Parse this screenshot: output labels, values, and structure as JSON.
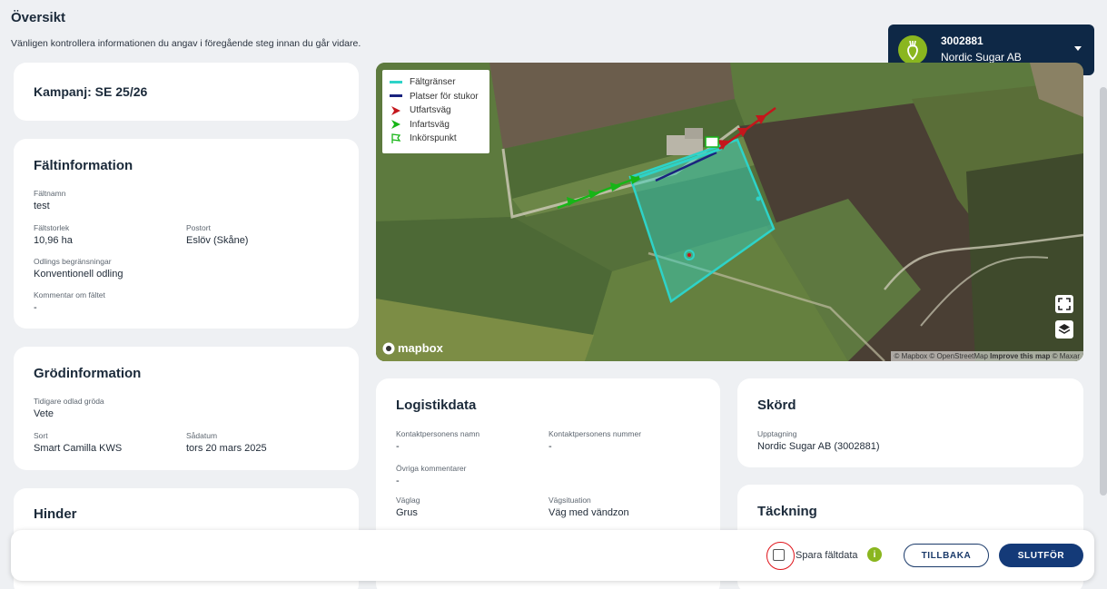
{
  "page": {
    "title": "Översikt",
    "subtitle": "Vänligen kontrollera informationen du angav i föregående steg innan du går vidare."
  },
  "account": {
    "id": "3002881",
    "name": "Nordic Sugar AB",
    "logo_icon": "sugar-beet-icon"
  },
  "campaign": {
    "label": "Kampanj: SE 25/26"
  },
  "field_info": {
    "title": "Fältinformation",
    "name_label": "Fältnamn",
    "name_value": "test",
    "size_label": "Fältstorlek",
    "size_value": "10,96 ha",
    "postort_label": "Postort",
    "postort_value": "Eslöv (Skåne)",
    "restrictions_label": "Odlings begränsningar",
    "restrictions_value": "Konventionell odling",
    "comment_label": "Kommentar om fältet",
    "comment_value": "-"
  },
  "crop_info": {
    "title": "Grödinformation",
    "previous_label": "Tidigare odlad gröda",
    "previous_value": "Vete",
    "variety_label": "Sort",
    "variety_value": "Smart Camilla KWS",
    "sowing_label": "Sådatum",
    "sowing_value": "tors 20 mars 2025"
  },
  "obstacles": {
    "title": "Hinder"
  },
  "logistics": {
    "title": "Logistikdata",
    "contact_name_label": "Kontaktpersonens namn",
    "contact_name_value": "-",
    "contact_number_label": "Kontaktpersonens nummer",
    "contact_number_value": "-",
    "other_comments_label": "Övriga kommentarer",
    "other_comments_value": "-",
    "road_label": "Väglag",
    "road_value": "Grus",
    "road_situation_label": "Vägsituation",
    "road_situation_value": "Väg med vändzon"
  },
  "harvest": {
    "title": "Skörd",
    "uptake_label": "Upptagning",
    "uptake_value": "Nordic Sugar AB (3002881)"
  },
  "coverage": {
    "title": "Täckning"
  },
  "map": {
    "legend": [
      {
        "label": "Fältgränser",
        "icon": "line-cyan",
        "color": "#2ed3c8"
      },
      {
        "label": "Platser för stukor",
        "icon": "line-navy",
        "color": "#1a237e"
      },
      {
        "label": "Utfartsväg",
        "icon": "arrow-red",
        "color": "#c4161c"
      },
      {
        "label": "Infartsväg",
        "icon": "arrow-green",
        "color": "#17b517"
      },
      {
        "label": "Inkörspunkt",
        "icon": "flag-green",
        "color": "#17b517"
      }
    ],
    "logo_text": "mapbox",
    "attribution_a": "© Mapbox © OpenStreetMap ",
    "attribution_b": "Improve this map",
    "attribution_c": " © Maxar"
  },
  "footer": {
    "save_label": "Spara fältdata",
    "back_label": "TILLBAKA",
    "finish_label": "SLUTFÖR"
  },
  "colors": {
    "navy": "#0e2846",
    "brand_green": "#8ab61f",
    "button_blue": "#143a78",
    "annotation_red": "#e0141b"
  }
}
